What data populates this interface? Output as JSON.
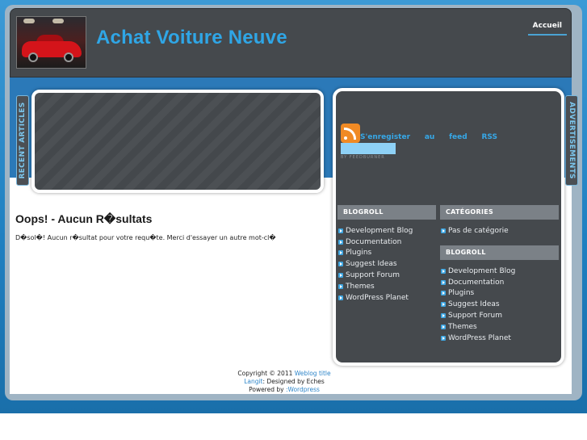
{
  "header": {
    "site_title": "Achat Voiture Neuve",
    "nav_home": "Accueil"
  },
  "tabs": {
    "recent_articles": "RECENT ARTICLES",
    "advertisements": "ADVERTISEMENTS"
  },
  "post": {
    "title": "Oops! - Aucun R�sultats",
    "body": "D�sol�! Aucun r�sultat pour votre requ�te. Merci d'essayer un autre mot-cl�"
  },
  "rss": {
    "words": [
      "S'enregister",
      "au",
      "feed",
      "RSS"
    ],
    "caption": "BY FEEDBURNER"
  },
  "widgets": {
    "blogroll_left": {
      "title": "BLOGROLL",
      "items": [
        "Development Blog",
        "Documentation",
        "Plugins",
        "Suggest Ideas",
        "Support Forum",
        "Themes",
        "WordPress Planet"
      ]
    },
    "categories": {
      "title": "CATÉGORIES",
      "items": [
        "Pas de catégorie"
      ]
    },
    "blogroll_right": {
      "title": "BLOGROLL",
      "items": [
        "Development Blog",
        "Documentation",
        "Plugins",
        "Suggest Ideas",
        "Support Forum",
        "Themes",
        "WordPress Planet"
      ]
    }
  },
  "footer": {
    "copyright": "Copyright © 2011",
    "blog_link": "Weblog title",
    "designer_link": "Langit",
    "designed_by": ": Designed by Eches",
    "powered_by": "Powered by",
    "wordpress_link": ":Wordpress"
  },
  "colors": {
    "accent_blue": "#2fa6e6",
    "dark_panel": "#45494d",
    "widget_header": "#7b8187"
  }
}
